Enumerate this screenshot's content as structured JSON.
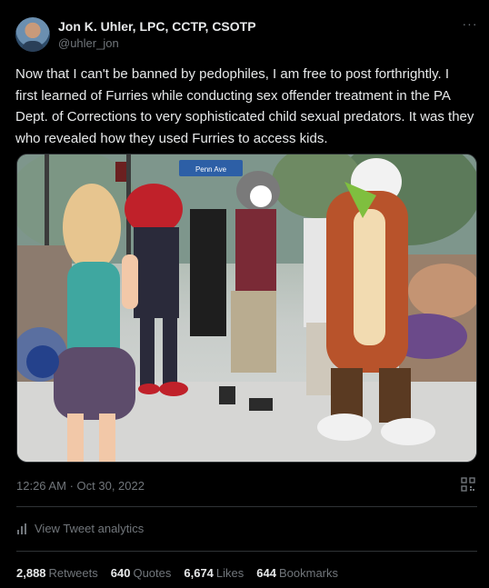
{
  "author": {
    "display_name": "Jon K. Uhler, LPC, CCTP, CSOTP",
    "handle": "@uhler_jon"
  },
  "tweet": {
    "text": "Now that I can't be banned by pedophiles, I am free to post forthrightly. I first learned of Furries while conducting sex offender treatment in the PA Dept. of Corrections to very sophisticated child sexual predators. It was they who revealed how they used Furries to access kids.",
    "time": "12:26 AM",
    "separator": "·",
    "date": "Oct 30, 2022"
  },
  "media": {
    "sign_text": "Penn Ave"
  },
  "analytics": {
    "label": "View Tweet analytics"
  },
  "stats": [
    {
      "value": "2,888",
      "label": "Retweets"
    },
    {
      "value": "640",
      "label": "Quotes"
    },
    {
      "value": "6,674",
      "label": "Likes"
    },
    {
      "value": "644",
      "label": "Bookmarks"
    }
  ],
  "icons": {
    "more": "more-icon",
    "analytics": "bar-chart-icon",
    "qr": "qr-code-icon"
  },
  "colors": {
    "background": "#000000",
    "text": "#e7e9ea",
    "secondary": "#71767b",
    "divider": "#2f3336"
  }
}
